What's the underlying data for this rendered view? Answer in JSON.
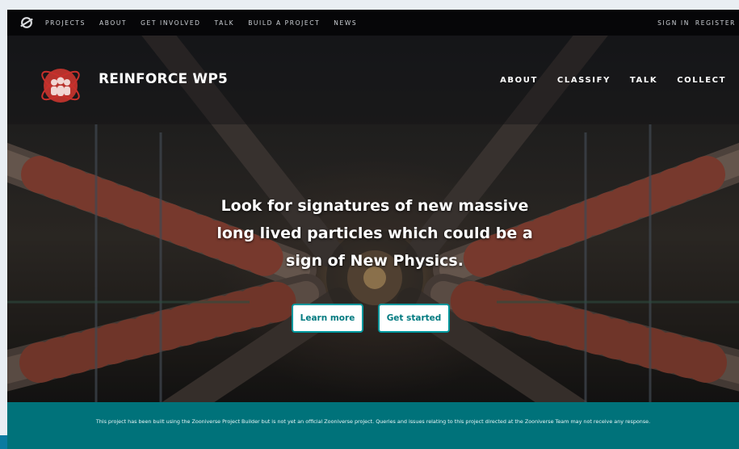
{
  "zooniverse_nav": {
    "items": [
      "PROJECTS",
      "ABOUT",
      "GET INVOLVED",
      "TALK",
      "BUILD A PROJECT",
      "NEWS"
    ],
    "sign_in": "SIGN IN",
    "register": "REGISTER"
  },
  "project": {
    "title": "REINFORCE WP5",
    "nav": [
      "ABOUT",
      "CLASSIFY",
      "TALK",
      "COLLECT"
    ]
  },
  "hero": {
    "tagline": "Look for signatures of new massive long lived particles which could be a sign of New Physics.",
    "learn_more": "Learn more",
    "get_started": "Get started"
  },
  "notice": "This project has been built using the Zooniverse Project Builder but is not yet an official Zooniverse project. Queries and issues relating to this project directed at the Zooniverse Team may not receive any response.",
  "colors": {
    "accent": "#00979d",
    "footer": "#00727a",
    "logo_red": "#c9302c"
  },
  "icons": {
    "zooniverse_logo": "zooniverse-logo-icon",
    "project_logo": "atom-people-icon"
  }
}
